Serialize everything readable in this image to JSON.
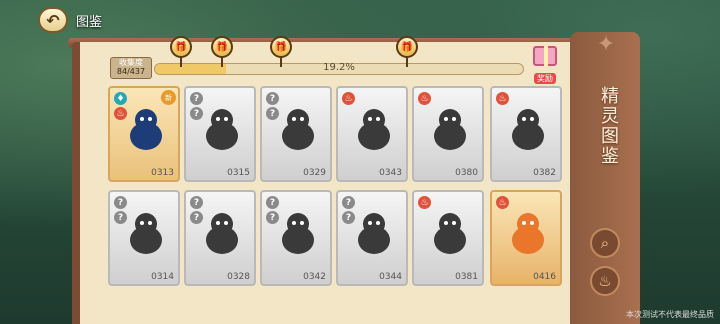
{
  "header": {
    "title": "图鉴"
  },
  "collection": {
    "label": "收集度",
    "count": "84/437",
    "progress_text": "19.2%",
    "progress_value": 0.192
  },
  "reward": {
    "label": "奖励"
  },
  "side": {
    "title": "精灵图鉴"
  },
  "cards": [
    {
      "num": "0313",
      "state": "active",
      "element": "fire",
      "new": "新"
    },
    {
      "num": "0315",
      "state": "gray",
      "element": "?"
    },
    {
      "num": "0329",
      "state": "gray",
      "element": "?"
    },
    {
      "num": "0343",
      "state": "gray",
      "element": "fire"
    },
    {
      "num": "0380",
      "state": "gray",
      "element": "fire"
    },
    {
      "num": "0382",
      "state": "gray",
      "element": "fire"
    },
    {
      "num": "0314",
      "state": "gray",
      "element": "?"
    },
    {
      "num": "0328",
      "state": "gray",
      "element": "?"
    },
    {
      "num": "0342",
      "state": "gray",
      "element": "?"
    },
    {
      "num": "0344",
      "state": "gray",
      "element": "?"
    },
    {
      "num": "0381",
      "state": "gray",
      "element": "fire"
    },
    {
      "num": "0416",
      "state": "featured",
      "element": "fire"
    }
  ],
  "footer": {
    "note": "本次测试不代表最终品质"
  }
}
